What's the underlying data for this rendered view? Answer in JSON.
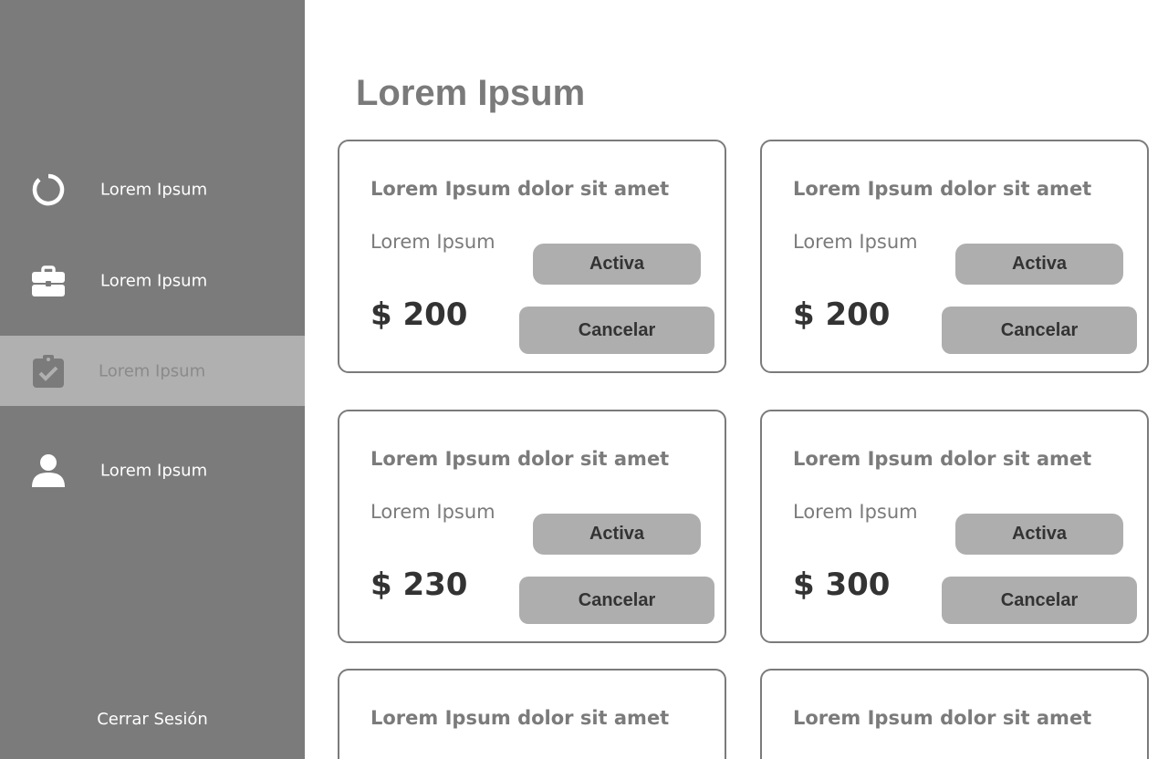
{
  "sidebar": {
    "items": [
      {
        "label": "Lorem Ipsum",
        "icon": "circle-loader-icon",
        "active": false
      },
      {
        "label": "Lorem Ipsum",
        "icon": "briefcase-icon",
        "active": false
      },
      {
        "label": "Lorem Ipsum",
        "icon": "clipboard-check-icon",
        "active": true
      },
      {
        "label": "Lorem Ipsum",
        "icon": "user-icon",
        "active": false
      }
    ],
    "logout_label": "Cerrar Sesión"
  },
  "main": {
    "title": "Lorem Ipsum",
    "cards": [
      {
        "title": "Lorem Ipsum dolor sit amet",
        "subtitle": "Lorem Ipsum",
        "price": "$ 200",
        "status_label": "Activa",
        "cancel_label": "Cancelar"
      },
      {
        "title": "Lorem Ipsum dolor sit amet",
        "subtitle": "Lorem Ipsum",
        "price": "$ 200",
        "status_label": "Activa",
        "cancel_label": "Cancelar"
      },
      {
        "title": "Lorem Ipsum dolor sit amet",
        "subtitle": "Lorem Ipsum",
        "price": "$ 230",
        "status_label": "Activa",
        "cancel_label": "Cancelar"
      },
      {
        "title": "Lorem Ipsum dolor sit amet",
        "subtitle": "Lorem Ipsum",
        "price": "$ 300",
        "status_label": "Activa",
        "cancel_label": "Cancelar"
      },
      {
        "title": "Lorem Ipsum dolor sit amet"
      },
      {
        "title": "Lorem Ipsum dolor sit amet"
      }
    ]
  },
  "colors": {
    "sidebar_bg": "#7b7b7b",
    "sidebar_active_bg": "#b0b0b0",
    "button_bg": "#aeaeae",
    "title_text": "#7a7a7a",
    "price_text": "#333333"
  }
}
